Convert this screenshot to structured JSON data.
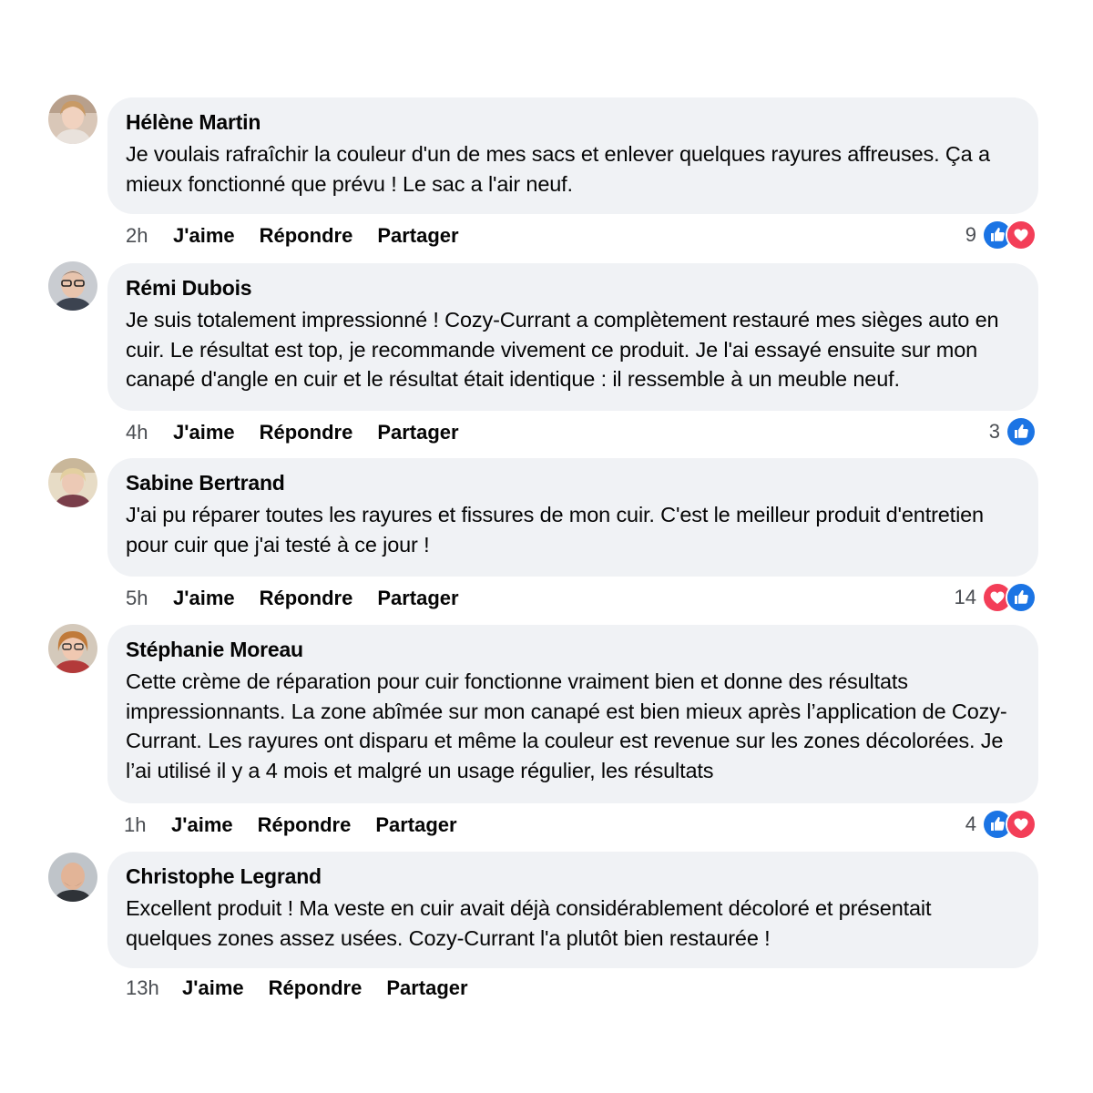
{
  "comments": [
    {
      "author": "Hélène Martin",
      "text": "Je voulais rafraîchir la couleur d'un de mes sacs et enlever quelques rayures affreuses. Ça a mieux fonctionné que prévu ! Le sac a l'air neuf.",
      "time": "2h",
      "like_label": "J'aime",
      "reply_label": "Répondre",
      "share_label": "Partager",
      "reaction_count": "9",
      "reactions": [
        "like-icon",
        "love-icon"
      ]
    },
    {
      "author": "Rémi Dubois",
      "text": "Je suis totalement impressionné ! Cozy-Currant a complètement restauré mes sièges auto en cuir. Le résultat est top, je recommande vivement ce produit. Je l'ai essayé ensuite sur mon canapé d'angle en cuir et le résultat était identique : il ressemble à un meuble neuf.",
      "time": "4h",
      "like_label": "J'aime",
      "reply_label": "Répondre",
      "share_label": "Partager",
      "reaction_count": "3",
      "reactions": [
        "like-icon"
      ]
    },
    {
      "author": "Sabine Bertrand",
      "text": "J'ai pu réparer toutes les rayures et fissures de mon cuir. C'est le meilleur produit d'entretien pour cuir que j'ai testé à ce jour !",
      "time": "5h",
      "like_label": "J'aime",
      "reply_label": "Répondre",
      "share_label": "Partager",
      "reaction_count": "14",
      "reactions": [
        "love-icon",
        "like-icon"
      ]
    },
    {
      "author": "Stéphanie Moreau",
      "text": "Cette crème de réparation pour cuir fonctionne vraiment bien et donne des résultats impressionnants. La zone abîmée sur mon canapé est bien mieux après l’application de Cozy-Currant. Les rayures ont disparu et même la couleur est revenue sur les zones décolorées. Je l’ai utilisé il y a 4 mois et malgré un usage régulier, les résultats",
      "time": "1h",
      "like_label": "J'aime",
      "reply_label": "Répondre",
      "share_label": "Partager",
      "reaction_count": "4",
      "reactions": [
        "like-icon",
        "love-icon"
      ]
    },
    {
      "author": "Christophe Legrand",
      "text": "Excellent produit ! Ma veste en cuir avait déjà considérablement décoloré et présentait quelques zones assez usées. Cozy-Currant l'a plutôt bien restaurée !",
      "time": "13h",
      "like_label": "J'aime",
      "reply_label": "Répondre",
      "share_label": "Partager",
      "reaction_count": "",
      "reactions": []
    }
  ],
  "colors": {
    "bubble": "#f0f2f5",
    "like_blue": "#1b74e4",
    "love_red": "#f33e58",
    "meta_text": "#4a4d52"
  }
}
